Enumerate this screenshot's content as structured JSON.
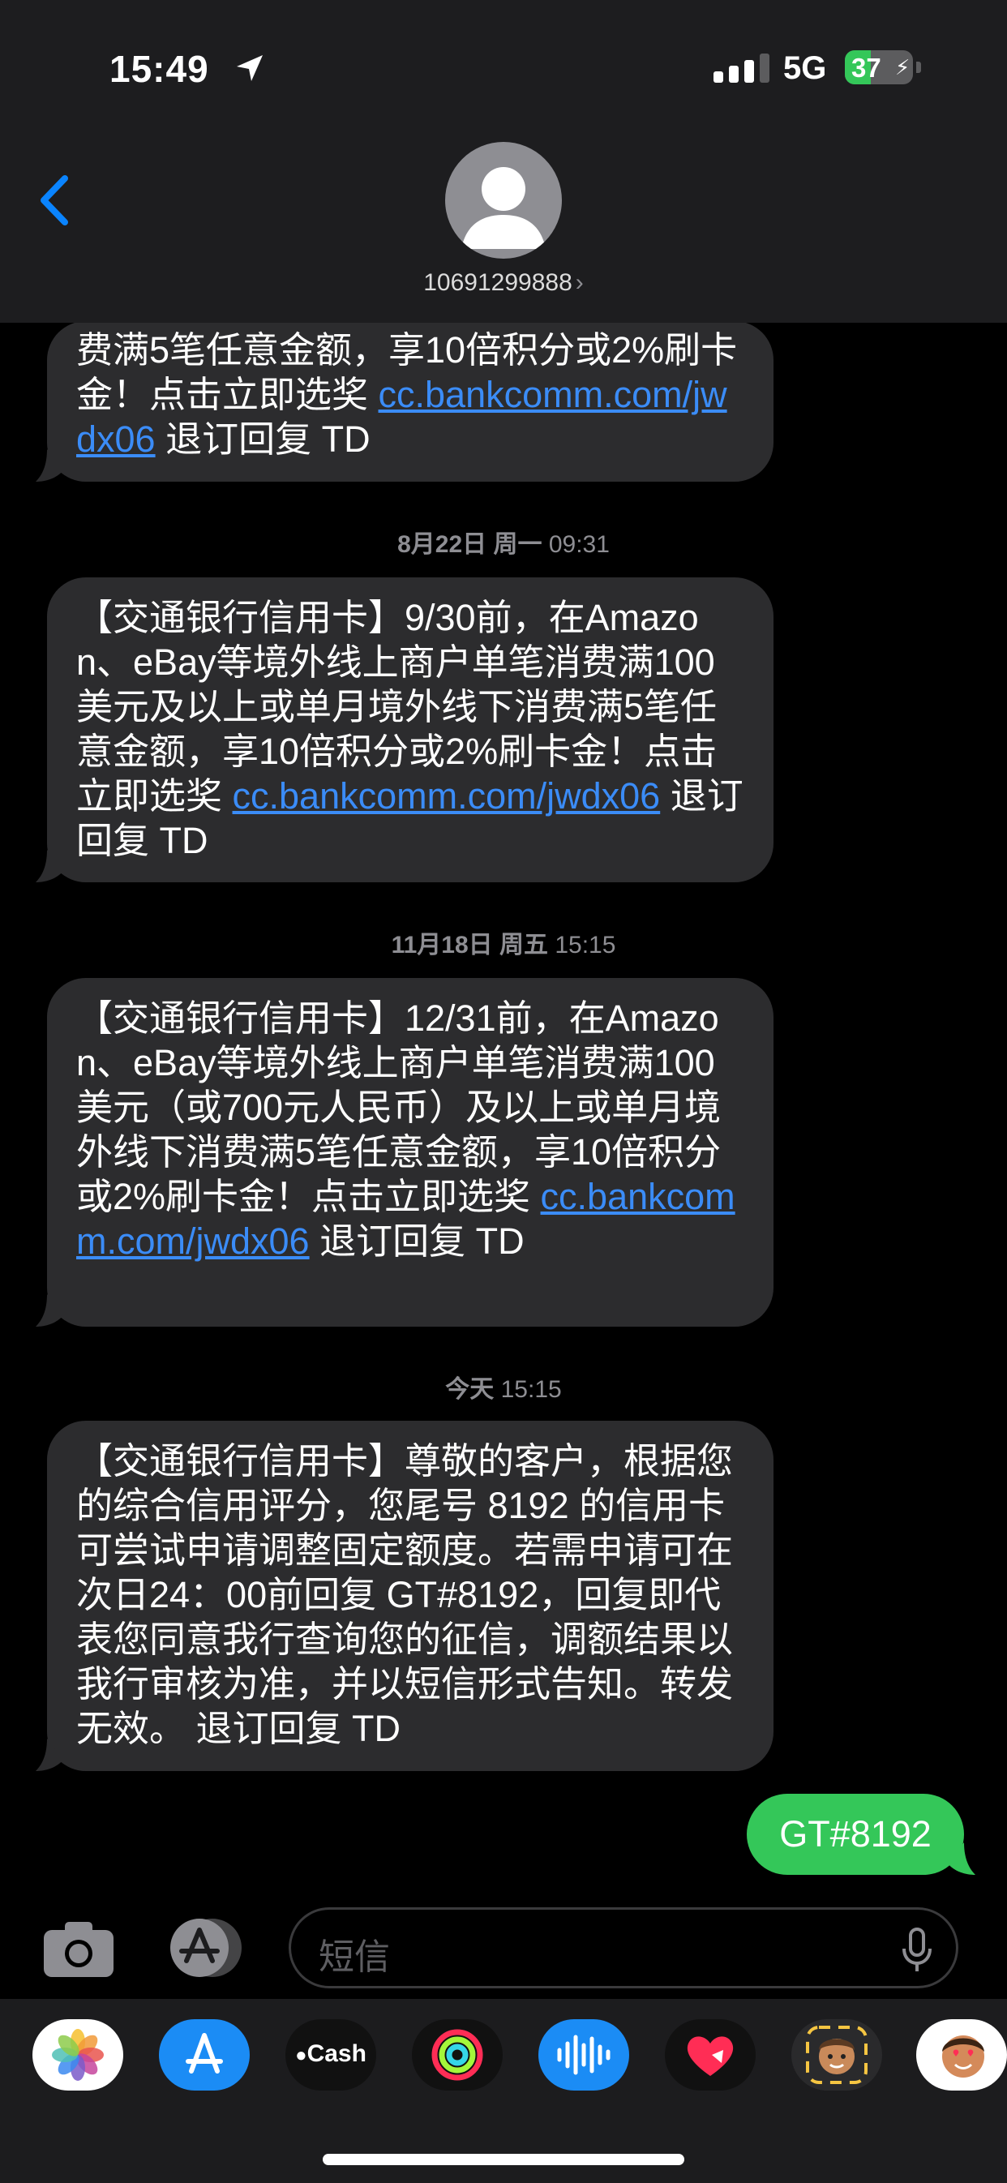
{
  "status": {
    "time": "15:49",
    "network": "5G",
    "battery": "37"
  },
  "header": {
    "contact": "10691299888",
    "chevron": "›"
  },
  "messages": [
    {
      "type": "in",
      "text": "费满5笔任意金额，享10倍积分或2%刷卡金！点击立即选奖 ",
      "link": "cc.bankcomm.com/jwdx06",
      "suffix": " 退订回复 TD"
    },
    {
      "type": "timestamp",
      "date": "8月22日 周一",
      "time": "09:31"
    },
    {
      "type": "in",
      "text": "【交通银行信用卡】9/30前，在Amazon、eBay等境外线上商户单笔消费满100美元及以上或单月境外线下消费满5笔任意金额，享10倍积分或2%刷卡金！点击立即选奖 ",
      "link": "cc.bankcomm.com/jwdx06",
      "suffix": " 退订回复 TD"
    },
    {
      "type": "timestamp",
      "date": "11月18日 周五",
      "time": "15:15"
    },
    {
      "type": "in",
      "text": "【交通银行信用卡】12/31前，在Amazon、eBay等境外线上商户单笔消费满100美元（或700元人民币）及以上或单月境外线下消费满5笔任意金额，享10倍积分或2%刷卡金！点击立即选奖 ",
      "link": "cc.bankcomm.com/jwdx06",
      "suffix": " 退订回复 TD"
    },
    {
      "type": "timestamp",
      "date": "今天",
      "time": "15:15"
    },
    {
      "type": "in",
      "text": "【交通银行信用卡】尊敬的客户，根据您的综合信用评分，您尾号 8192 的信用卡可尝试申请调整固定额度。若需申请可在次日24：00前回复 GT#8192，回复即代表您同意我行查询您的征信，调额结果以我行审核为准，并以短信形式告知。转发无效。 退订回复 TD"
    },
    {
      "type": "out",
      "text": "GT#8192"
    }
  ],
  "input": {
    "placeholder": "短信"
  },
  "apps": [
    "photos-icon",
    "app-store-icon",
    "apple-cash-icon",
    "fitness-icon",
    "voice-memo-icon",
    "heart-digital-touch-icon",
    "memoji-icon",
    "memoji-stickers-icon"
  ],
  "apps_labels": {
    "cash": "Cash"
  },
  "colors": {
    "bubble_in": "#2c2c2e",
    "bubble_out": "#34c759",
    "link": "#3b8cf7",
    "accent": "#0a84ff"
  }
}
